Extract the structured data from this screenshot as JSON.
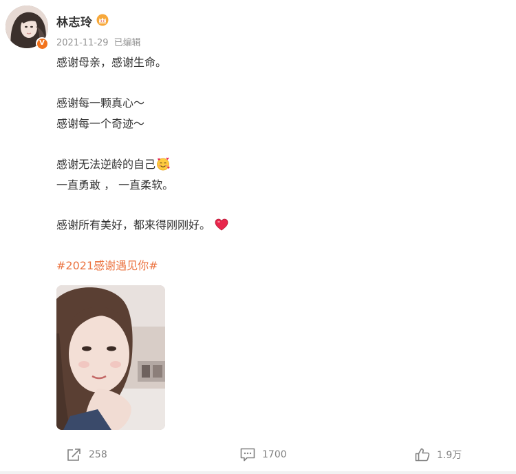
{
  "post": {
    "author": "林志玲",
    "date": "2021-11-29",
    "edited_label": "已编辑",
    "lines": [
      "感谢母亲，感谢生命。",
      "感谢每一颗真心～",
      "感谢每一个奇迹～",
      "感谢无法逆龄的自己",
      "一直勇敢 ， 一直柔软。",
      "感谢所有美好，都来得刚刚好。"
    ],
    "hashtag": "#2021感谢遇见你#",
    "verify_badge": "V"
  },
  "actions": {
    "share_count": "258",
    "comment_count": "1700",
    "like_count": "1.9万"
  },
  "icons": {
    "crown": "crown-icon",
    "verify": "verified-badge-icon",
    "face_emoji": "smiling-face-with-hearts-icon",
    "heart_emoji": "red-heart-icon",
    "share": "share-icon",
    "comment": "comment-icon",
    "like": "thumbs-up-icon"
  },
  "colors": {
    "hashtag": "#eb7340",
    "verify": "#f2731c",
    "meta": "#939393",
    "action": "#808080"
  }
}
